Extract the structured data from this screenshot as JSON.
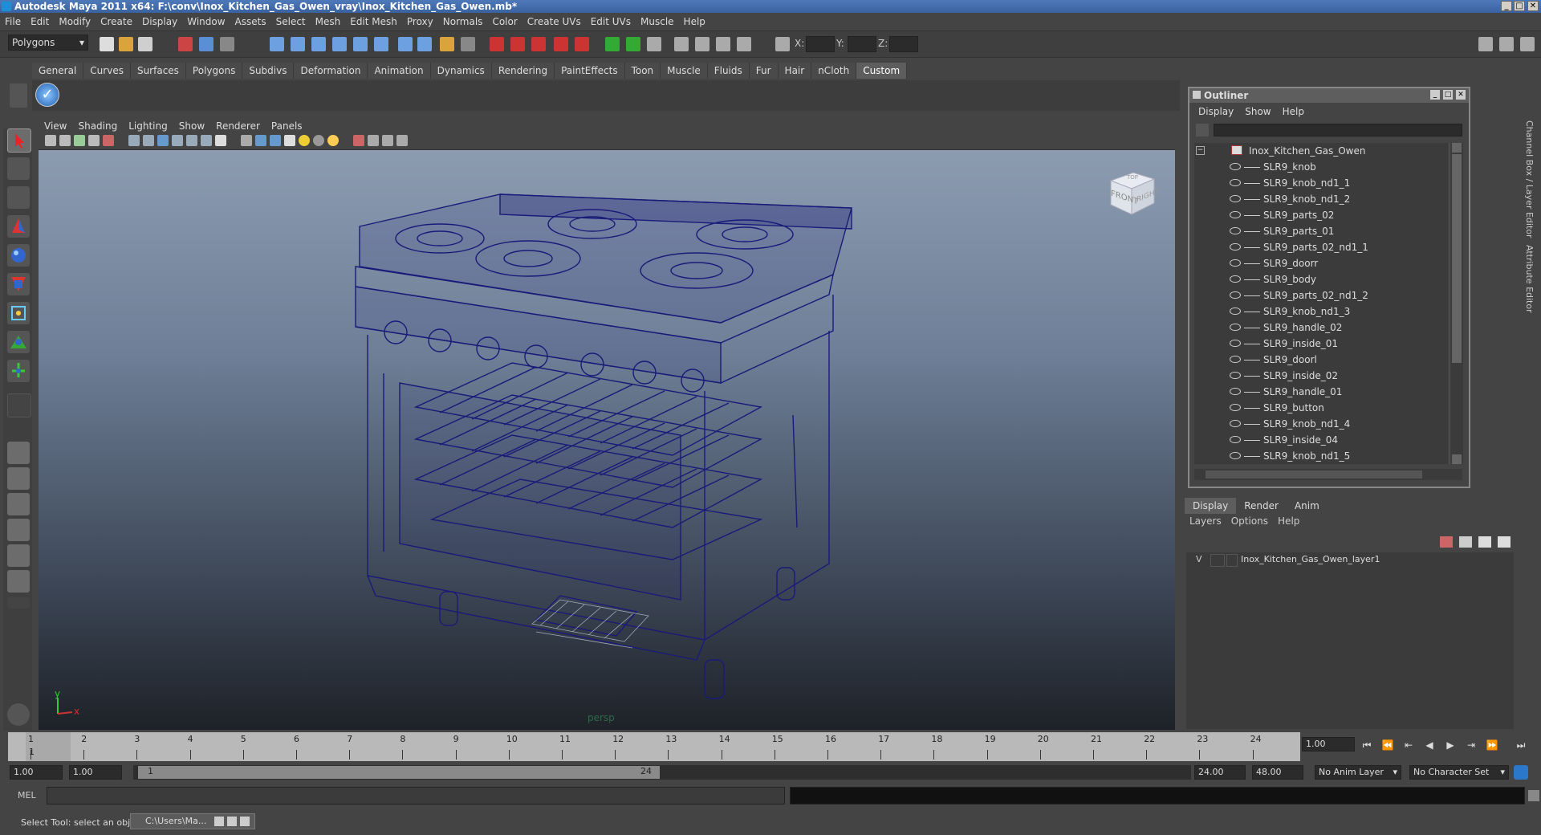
{
  "window": {
    "title": "Autodesk Maya 2011 x64: F:\\conv\\Inox_Kitchen_Gas_Owen_vray\\Inox_Kitchen_Gas_Owen.mb*"
  },
  "menubar": [
    "File",
    "Edit",
    "Modify",
    "Create",
    "Display",
    "Window",
    "Assets",
    "Select",
    "Mesh",
    "Edit Mesh",
    "Proxy",
    "Normals",
    "Color",
    "Create UVs",
    "Edit UVs",
    "Muscle",
    "Help"
  ],
  "status_line": {
    "mode": "Polygons",
    "x_label": "X:",
    "y_label": "Y:",
    "z_label": "Z:"
  },
  "shelf_tabs": [
    "General",
    "Curves",
    "Surfaces",
    "Polygons",
    "Subdivs",
    "Deformation",
    "Animation",
    "Dynamics",
    "Rendering",
    "PaintEffects",
    "Toon",
    "Muscle",
    "Fluids",
    "Fur",
    "Hair",
    "nCloth",
    "Custom"
  ],
  "active_shelf": "Custom",
  "viewport": {
    "menus": [
      "View",
      "Shading",
      "Lighting",
      "Show",
      "Renderer",
      "Panels"
    ],
    "camera_label": "persp",
    "viewcube_front": "FRONT",
    "viewcube_right": "RIGHT",
    "viewcube_top": "TOP",
    "axis_y": "y",
    "axis_x": "x"
  },
  "outliner": {
    "title": "Outliner",
    "menus": [
      "Display",
      "Show",
      "Help"
    ],
    "root": "Inox_Kitchen_Gas_Owen",
    "items": [
      "SLR9_knob",
      "SLR9_knob_nd1_1",
      "SLR9_knob_nd1_2",
      "SLR9_parts_02",
      "SLR9_parts_01",
      "SLR9_parts_02_nd1_1",
      "SLR9_doorr",
      "SLR9_body",
      "SLR9_parts_02_nd1_2",
      "SLR9_knob_nd1_3",
      "SLR9_handle_02",
      "SLR9_inside_01",
      "SLR9_doorl",
      "SLR9_inside_02",
      "SLR9_handle_01",
      "SLR9_button",
      "SLR9_knob_nd1_4",
      "SLR9_inside_04",
      "SLR9_knob_nd1_5"
    ]
  },
  "side_tabs": {
    "channel_box": "Channel Box / Layer Editor",
    "attribute_editor": "Attribute Editor"
  },
  "layer_editor": {
    "tabs": [
      "Display",
      "Render",
      "Anim"
    ],
    "active_tab": "Display",
    "menus": [
      "Layers",
      "Options",
      "Help"
    ],
    "layer": {
      "visible": "V",
      "name": "Inox_Kitchen_Gas_Owen_layer1"
    }
  },
  "time_slider": {
    "ticks": [
      "1",
      "2",
      "3",
      "4",
      "5",
      "6",
      "7",
      "8",
      "9",
      "10",
      "11",
      "12",
      "13",
      "14",
      "15",
      "16",
      "17",
      "18",
      "19",
      "20",
      "21",
      "22",
      "23",
      "24"
    ],
    "current_frame": "1",
    "current_time_field": "1.00"
  },
  "range_slider": {
    "start_time": "1.00",
    "playback_start": "1.00",
    "range_start_label": "1",
    "range_end_label": "24",
    "playback_end": "24.00",
    "end_time": "48.00",
    "anim_layer": "No Anim Layer",
    "character_set": "No Character Set"
  },
  "command_line": {
    "label": "MEL"
  },
  "help_line": {
    "text": "Select Tool: select an object",
    "taskbar_item": "C:\\Users\\Ma..."
  },
  "colors": {
    "wire": "#1a1a78",
    "titlebar": "#3a62a0",
    "panel": "#444444",
    "timeslider": "#b9b9b9",
    "active_tab": "#5d5d5d"
  }
}
